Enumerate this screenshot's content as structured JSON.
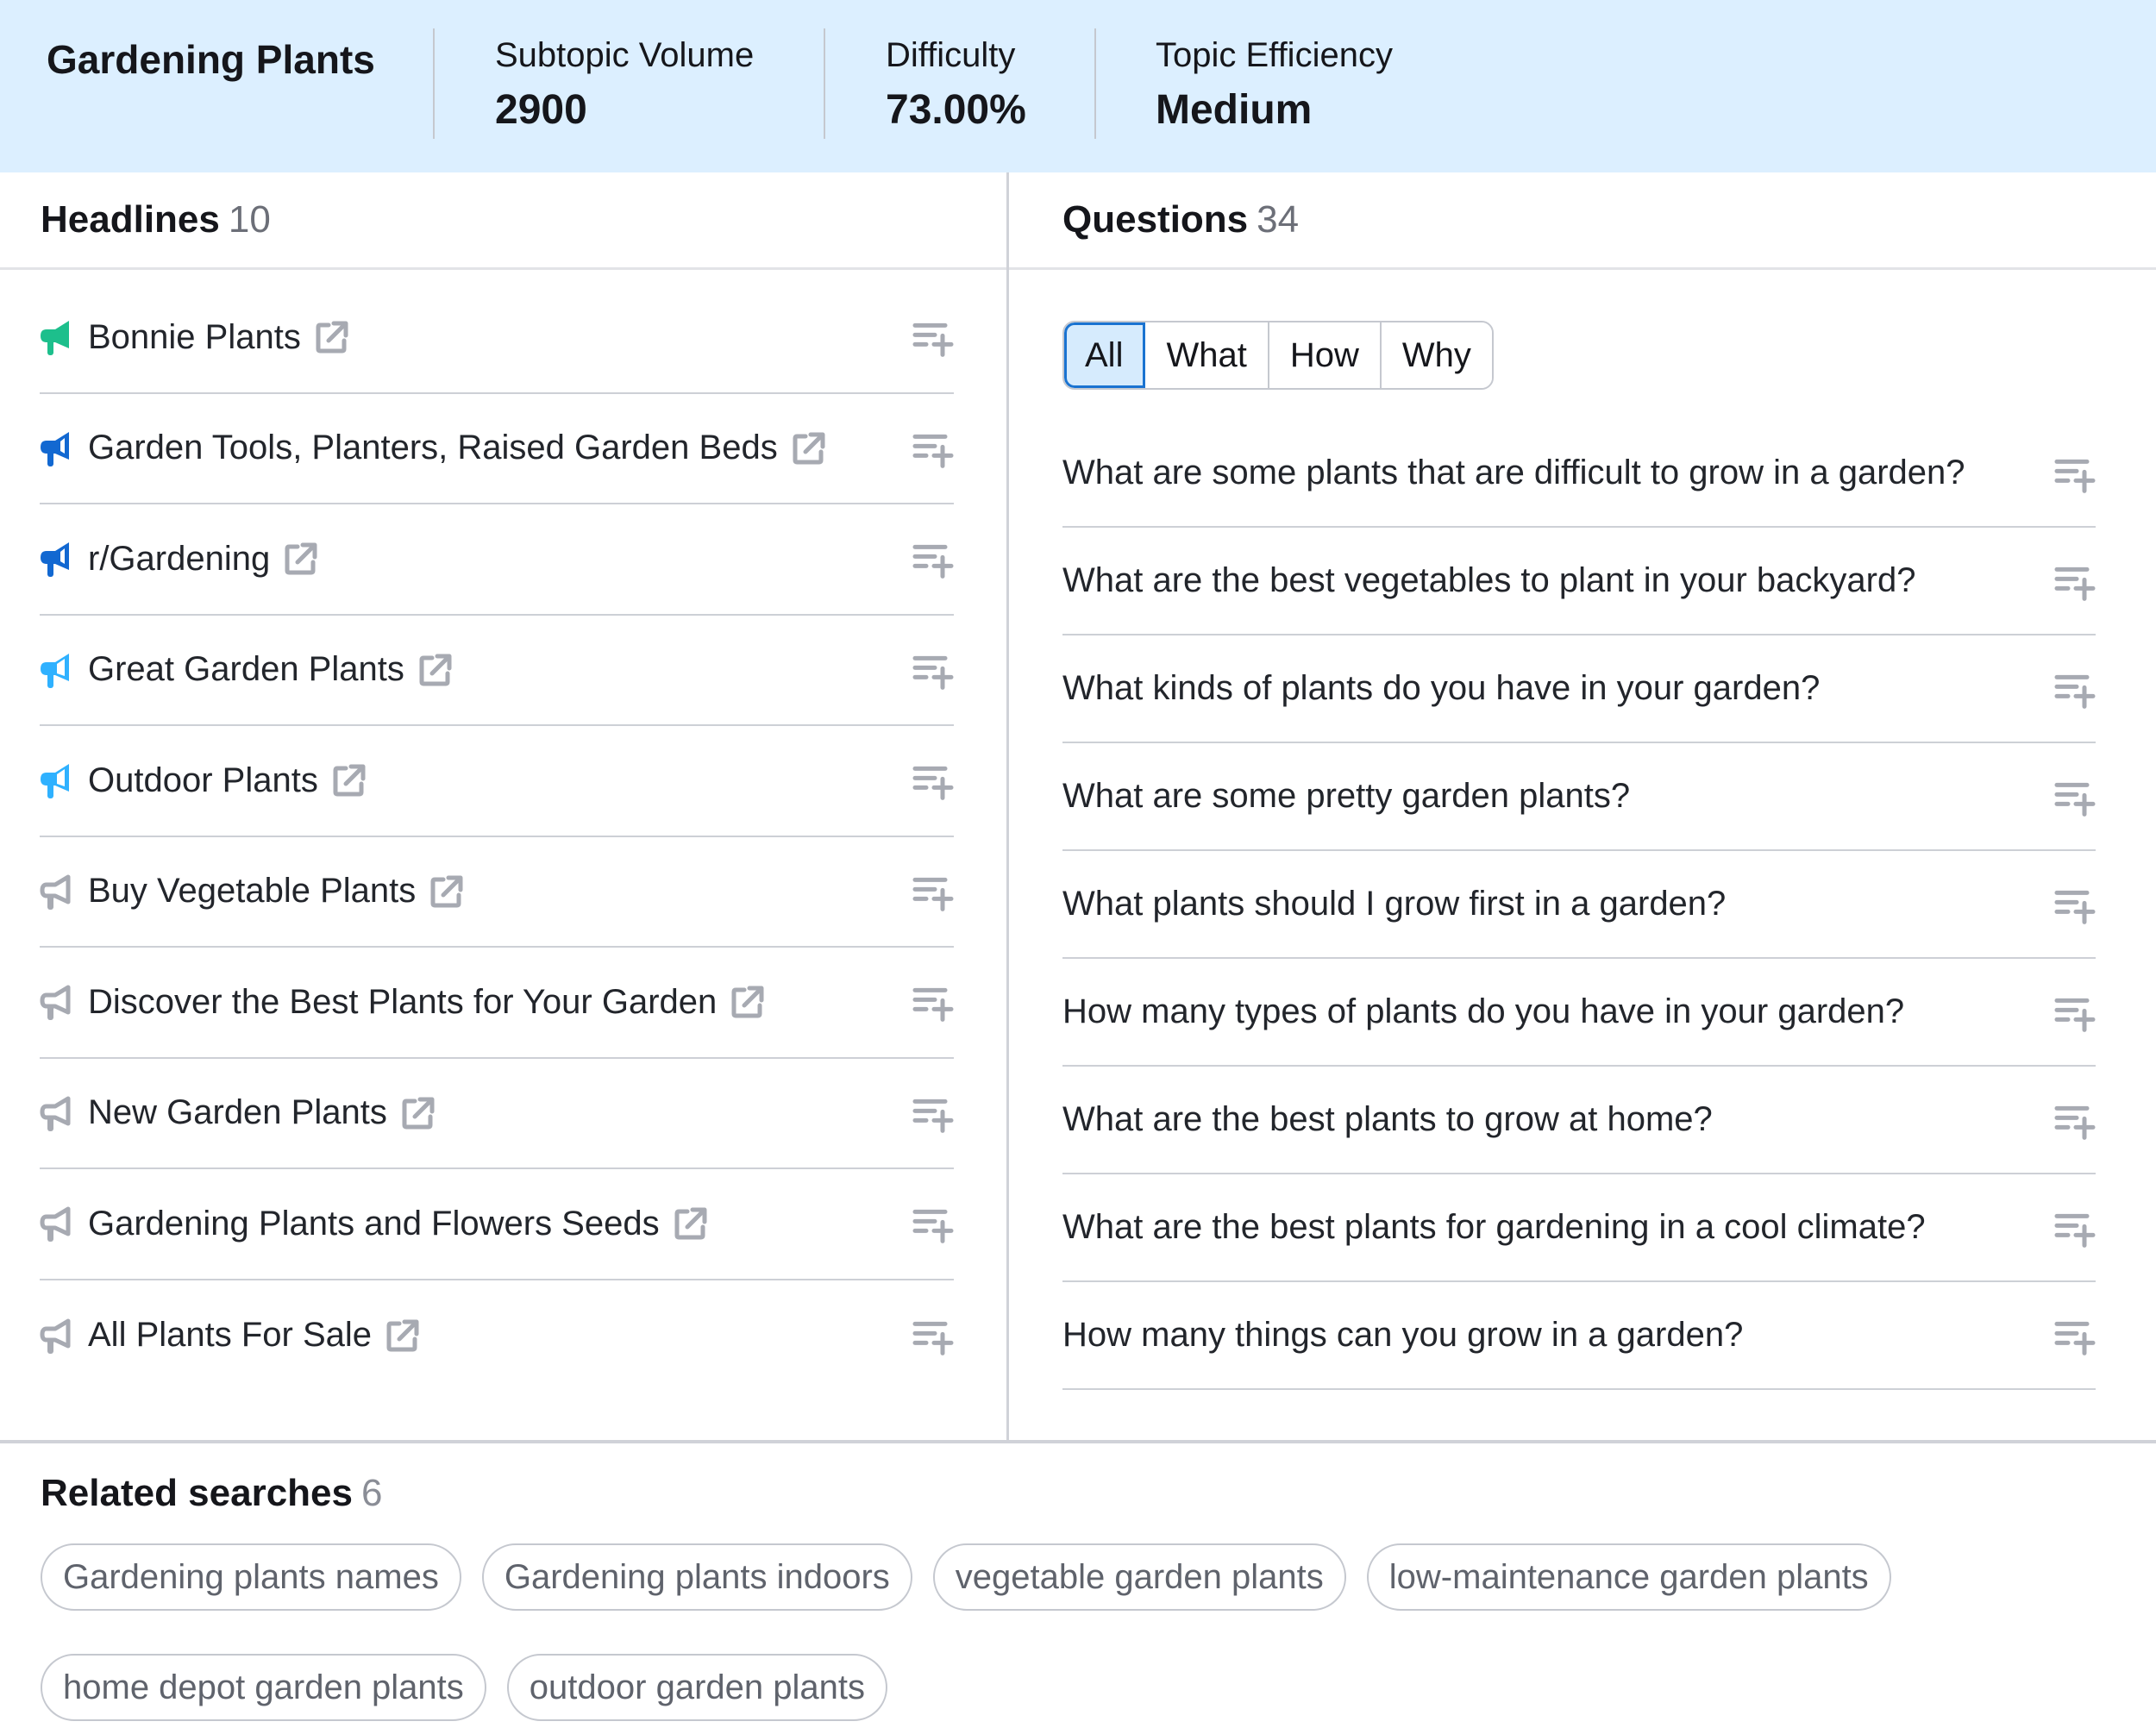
{
  "summary": {
    "topic": "Gardening Plants",
    "metrics": [
      {
        "label": "Subtopic Volume",
        "value": "2900"
      },
      {
        "label": "Difficulty",
        "value": "73.00%"
      },
      {
        "label": "Topic Efficiency",
        "value": "Medium"
      }
    ]
  },
  "headlines": {
    "title": "Headlines",
    "count": "10",
    "colors": {
      "top": "#1dbf8c",
      "high": "#1268d1",
      "mid": "#2fb1ff",
      "low": "#a7aab2"
    },
    "items": [
      {
        "text": "Bonnie Plants",
        "rank": "top",
        "icon": "megaphone-icon"
      },
      {
        "text": "Garden Tools, Planters, Raised Garden Beds",
        "rank": "high",
        "icon": "megaphone-icon"
      },
      {
        "text": "r/Gardening",
        "rank": "high",
        "icon": "megaphone-icon"
      },
      {
        "text": "Great Garden Plants",
        "rank": "mid",
        "icon": "megaphone-icon"
      },
      {
        "text": "Outdoor Plants",
        "rank": "mid",
        "icon": "megaphone-icon"
      },
      {
        "text": "Buy Vegetable Plants",
        "rank": "low",
        "icon": "megaphone-outline-icon"
      },
      {
        "text": "Discover the Best Plants for Your Garden",
        "rank": "low",
        "icon": "megaphone-outline-icon"
      },
      {
        "text": "New Garden Plants",
        "rank": "low",
        "icon": "megaphone-outline-icon"
      },
      {
        "text": "Gardening Plants and Flowers Seeds",
        "rank": "low",
        "icon": "megaphone-outline-icon"
      },
      {
        "text": "All Plants For Sale",
        "rank": "low",
        "icon": "megaphone-outline-icon"
      }
    ]
  },
  "questions": {
    "title": "Questions",
    "count": "34",
    "filters": [
      {
        "label": "All",
        "active": true
      },
      {
        "label": "What",
        "active": false
      },
      {
        "label": "How",
        "active": false
      },
      {
        "label": "Why",
        "active": false
      }
    ],
    "items": [
      "What are some plants that are difficult to grow in a garden?",
      "What are the best vegetables to plant in your backyard?",
      "What kinds of plants do you have in your garden?",
      "What are some pretty garden plants?",
      "What plants should I grow first in a garden?",
      "How many types of plants do you have in your garden?",
      "What are the best plants to grow at home?",
      "What are the best plants for gardening in a cool climate?",
      "How many things can you grow in a garden?"
    ]
  },
  "related": {
    "title": "Related searches",
    "count": "6",
    "items": [
      "Gardening plants names",
      "Gardening plants indoors",
      "vegetable garden plants",
      "low-maintenance garden plants",
      "home depot garden plants",
      "outdoor garden plants"
    ]
  },
  "icons": {
    "external": "external-link-icon",
    "add": "add-to-list-icon"
  }
}
